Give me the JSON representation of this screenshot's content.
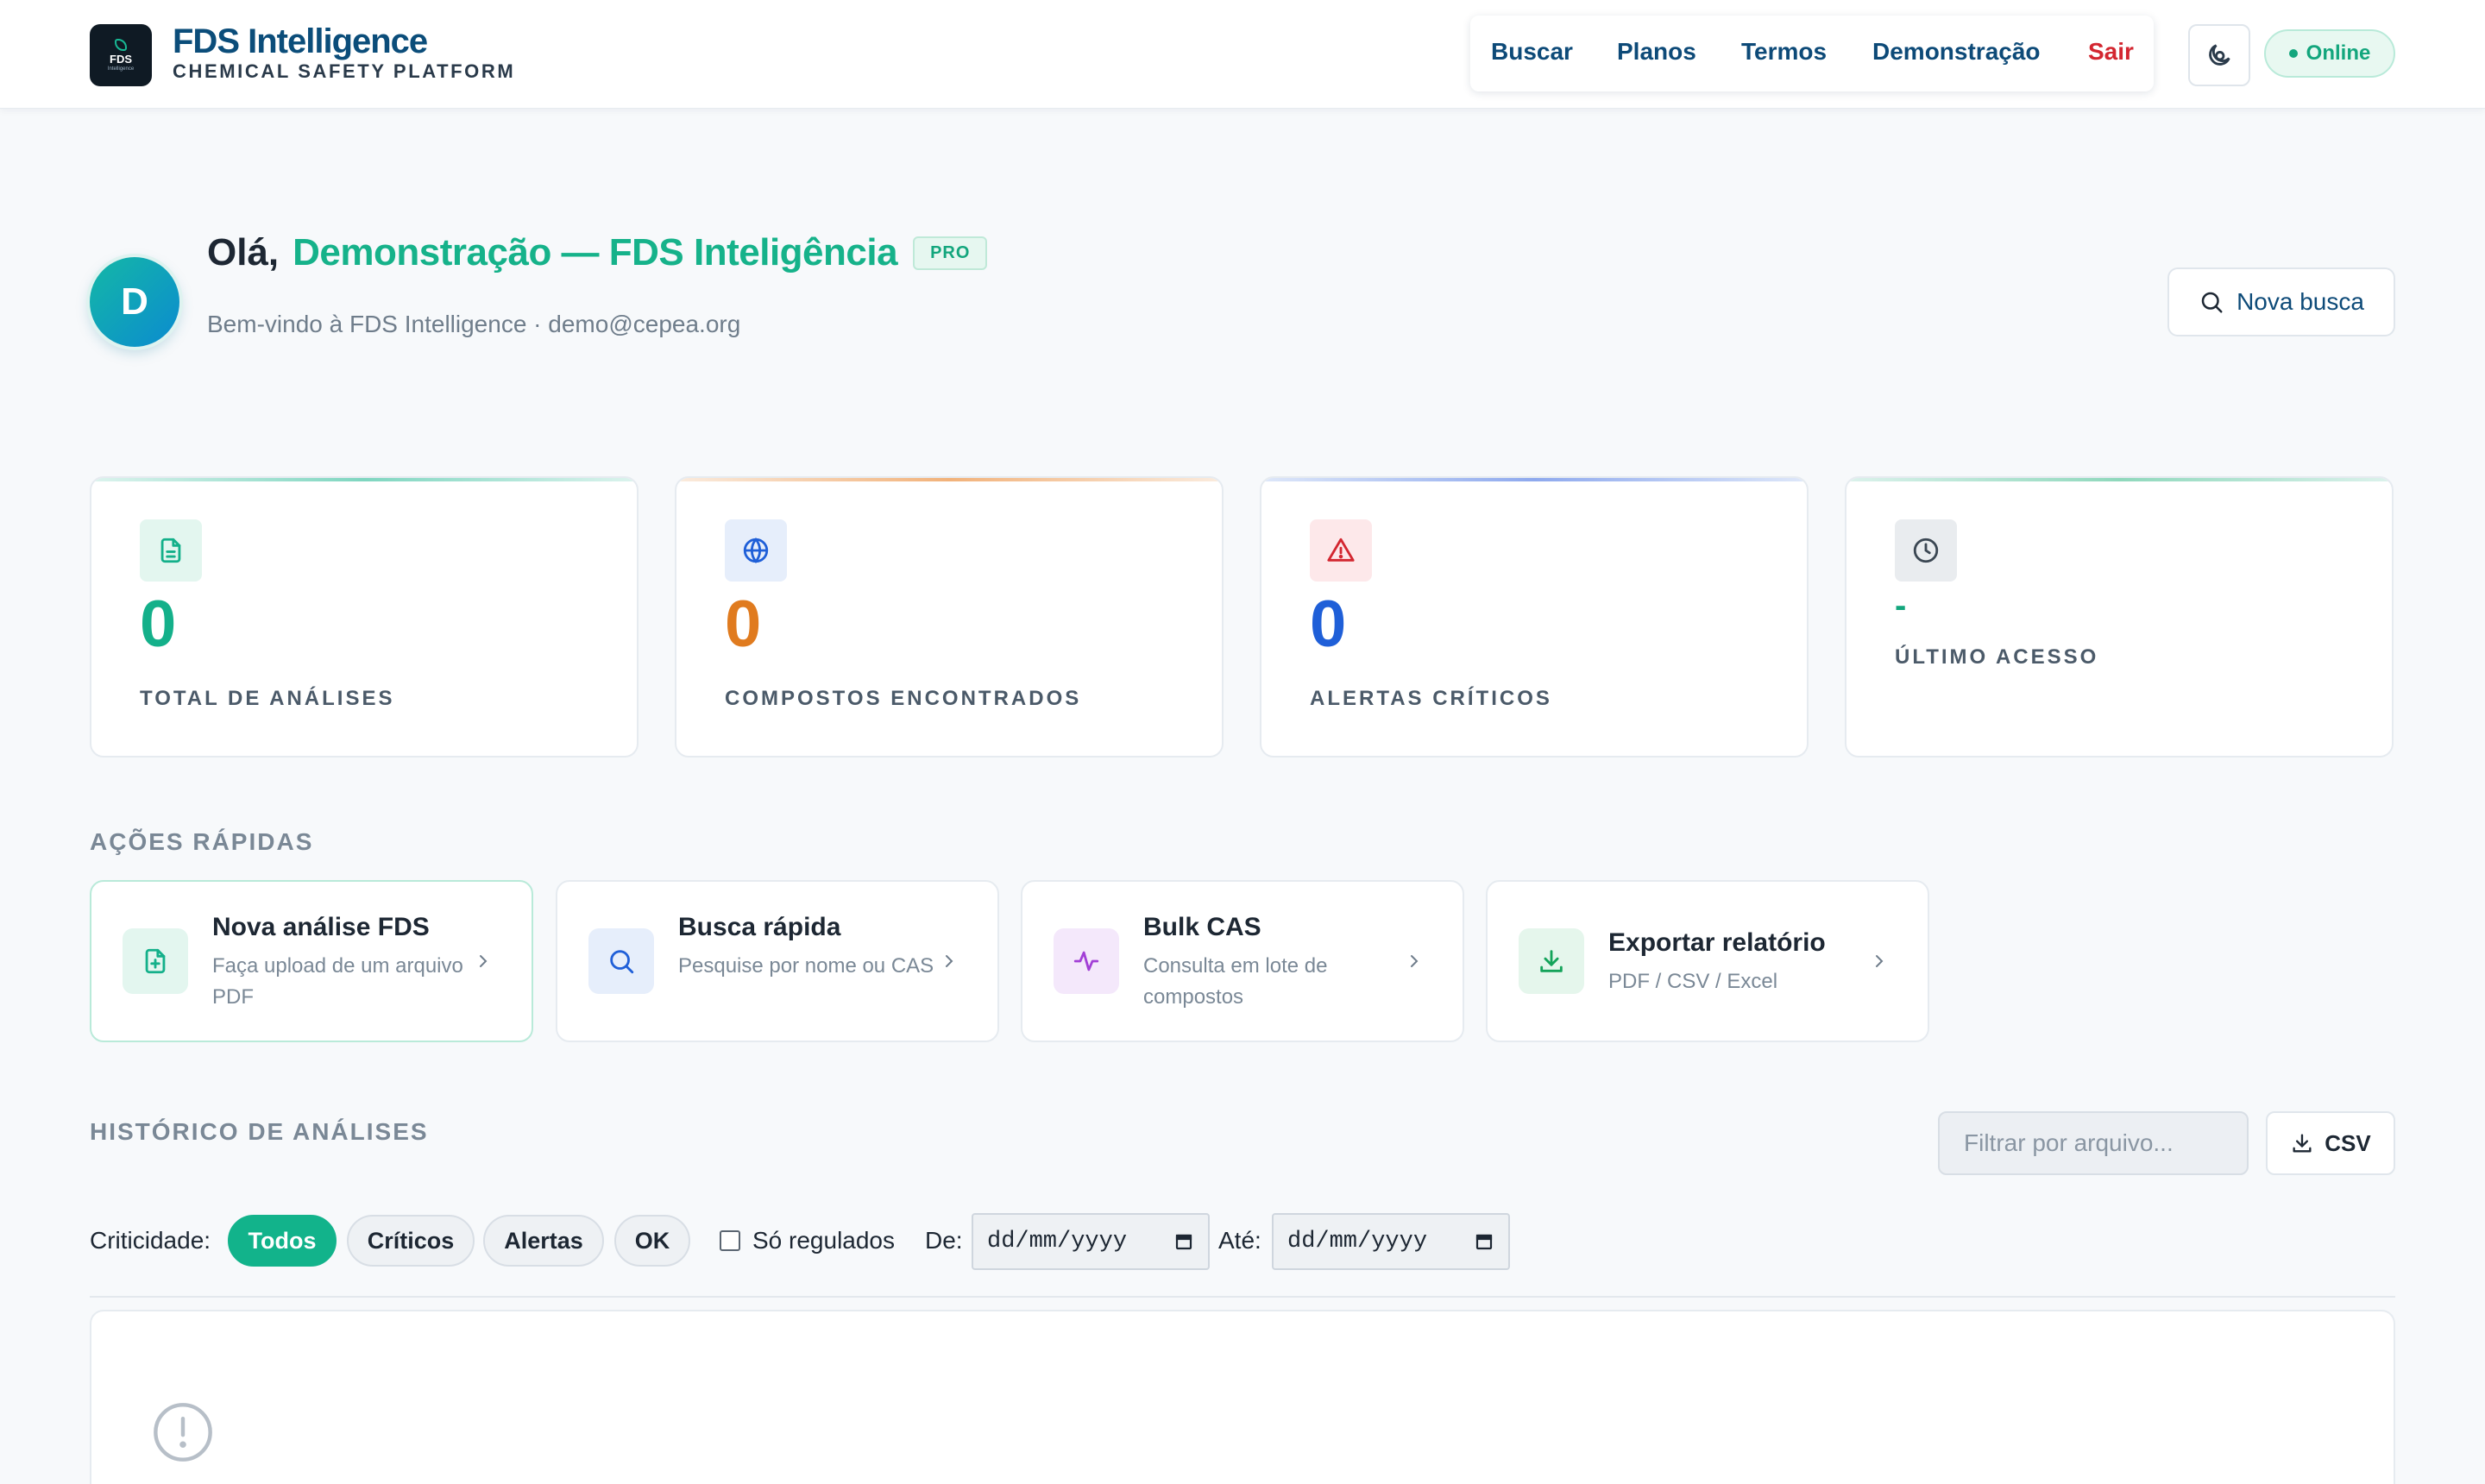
{
  "header": {
    "logo_text": "FDS",
    "logo_subtext": "Intelligence",
    "brand_title": "FDS Intelligence",
    "brand_subtitle": "CHEMICAL SAFETY PLATFORM",
    "nav": [
      "Buscar",
      "Planos",
      "Termos",
      "Demonstração",
      "Sair"
    ],
    "theme_icon": "theme-toggle-icon",
    "status": "Online",
    "colors": {
      "brand": "#0b4d7a",
      "accent": "#16b28a",
      "danger": "#d32630"
    }
  },
  "greeting": {
    "avatar_initial": "D",
    "hello": "Olá,",
    "name": "Demonstração — FDS Inteligência",
    "badge": "PRO",
    "welcome": "Bem-vindo à FDS Intelligence · demo@cepea.org",
    "new_search_label": "Nova busca"
  },
  "stats": [
    {
      "icon": "document-icon",
      "value": "0",
      "label": "TOTAL DE ANÁLISES",
      "color": "#14b08a"
    },
    {
      "icon": "globe-icon",
      "value": "0",
      "label": "COMPOSTOS ENCONTRADOS",
      "color": "#e07b1f"
    },
    {
      "icon": "warning-icon",
      "value": "0",
      "label": "ALERTAS CRÍTICOS",
      "color": "#1f5fd8"
    },
    {
      "icon": "clock-icon",
      "value": "-",
      "label": "ÚLTIMO ACESSO",
      "color": "#13a67d"
    }
  ],
  "quick_actions": {
    "title": "AÇÕES RÁPIDAS",
    "items": [
      {
        "title": "Nova análise FDS",
        "description": "Faça upload de um arquivo PDF",
        "icon": "file-upload-icon"
      },
      {
        "title": "Busca rápida",
        "description": "Pesquise por nome ou CAS",
        "icon": "search-icon"
      },
      {
        "title": "Bulk CAS",
        "description": "Consulta em lote de compostos",
        "icon": "activity-icon"
      },
      {
        "title": "Exportar relatório",
        "description": "PDF / CSV / Excel",
        "icon": "download-icon"
      }
    ]
  },
  "history": {
    "title": "HISTÓRICO DE ANÁLISES",
    "filter_placeholder": "Filtrar por arquivo...",
    "csv_label": "CSV",
    "criticality_label": "Criticidade:",
    "chips": [
      "Todos",
      "Críticos",
      "Alertas",
      "OK"
    ],
    "active_chip": "Todos",
    "only_regulated_label": "Só regulados",
    "from_label": "De:",
    "to_label": "Até:",
    "date_placeholder": "dd/mm/yyyy",
    "empty_icon": "info-circle-icon"
  }
}
